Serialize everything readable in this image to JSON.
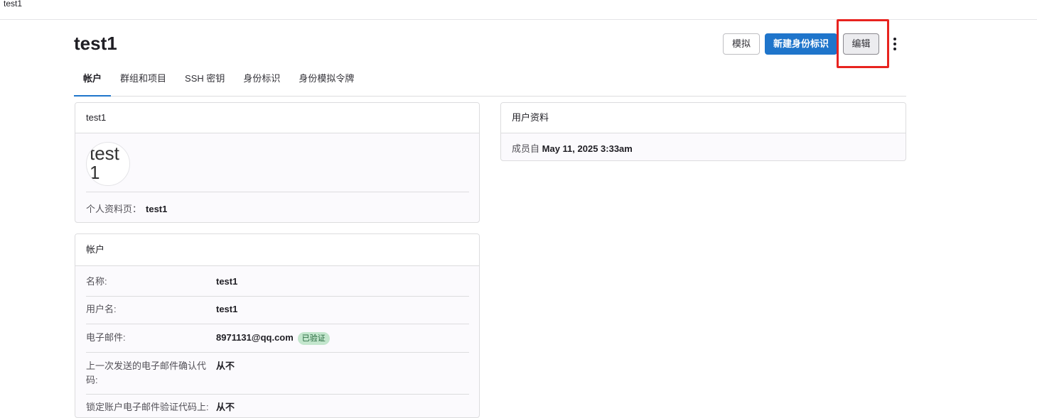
{
  "topbar": {
    "title": "test1"
  },
  "header": {
    "title": "test1",
    "impersonate_label": "模拟",
    "new_identity_label": "新建身份标识",
    "edit_label": "编辑"
  },
  "tabs": [
    {
      "label": "帐户"
    },
    {
      "label": "群组和项目"
    },
    {
      "label": "SSH 密钥"
    },
    {
      "label": "身份标识"
    },
    {
      "label": "身份模拟令牌"
    }
  ],
  "user_card": {
    "title": "test1",
    "avatar_text": "test1",
    "profile_label": "个人资料页：",
    "profile_value": "test1"
  },
  "profile_card": {
    "title": "用户资料",
    "member_since_label": "成员自",
    "member_since_value": "May 11, 2025 3:33am"
  },
  "account_card": {
    "title": "帐户",
    "rows": [
      {
        "label": "名称:",
        "value": "test1"
      },
      {
        "label": "用户名:",
        "value": "test1"
      },
      {
        "label": "电子邮件:",
        "value": "8971131@qq.com",
        "badge": "已验证"
      },
      {
        "label": "上一次发送的电子邮件确认代码:",
        "value": "从不"
      },
      {
        "label": "锁定账户电子邮件验证代码上:",
        "value": "从不"
      }
    ]
  },
  "colors": {
    "primary": "#1f75cb",
    "highlight": "#e8231f",
    "badge_bg": "#c3e6cd",
    "badge_text": "#24663b"
  }
}
